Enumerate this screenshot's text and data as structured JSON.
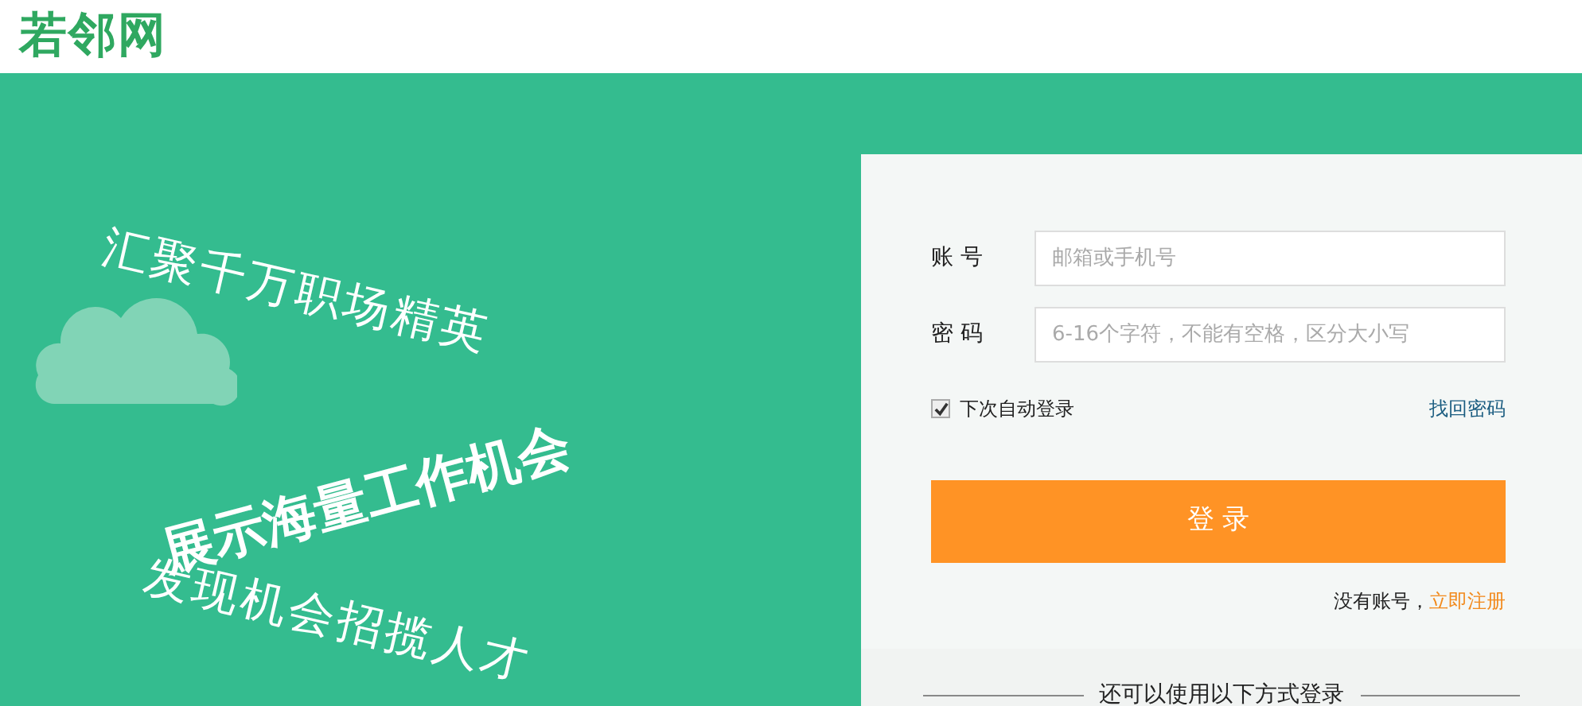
{
  "header": {
    "logo": "若邻网"
  },
  "slogans": [
    {
      "text": "汇聚千万职场精英",
      "kind": "light"
    },
    {
      "text": "展示海量工作机会",
      "kind": "bold"
    },
    {
      "text": "发现机会招揽人才",
      "kind": "light"
    }
  ],
  "login": {
    "fields": [
      {
        "label": "账 号",
        "placeholder": "邮箱或手机号"
      },
      {
        "label": "密 码",
        "placeholder": "6-16个字符，不能有空格，区分大小写"
      }
    ],
    "remember": {
      "label": "下次自动登录",
      "checked": true
    },
    "forgot_link": "找回密码",
    "submit": "登 录",
    "register_prompt": "没有账号，",
    "register_link": "立即注册",
    "alt_login_heading": "还可以使用以下方式登录"
  }
}
